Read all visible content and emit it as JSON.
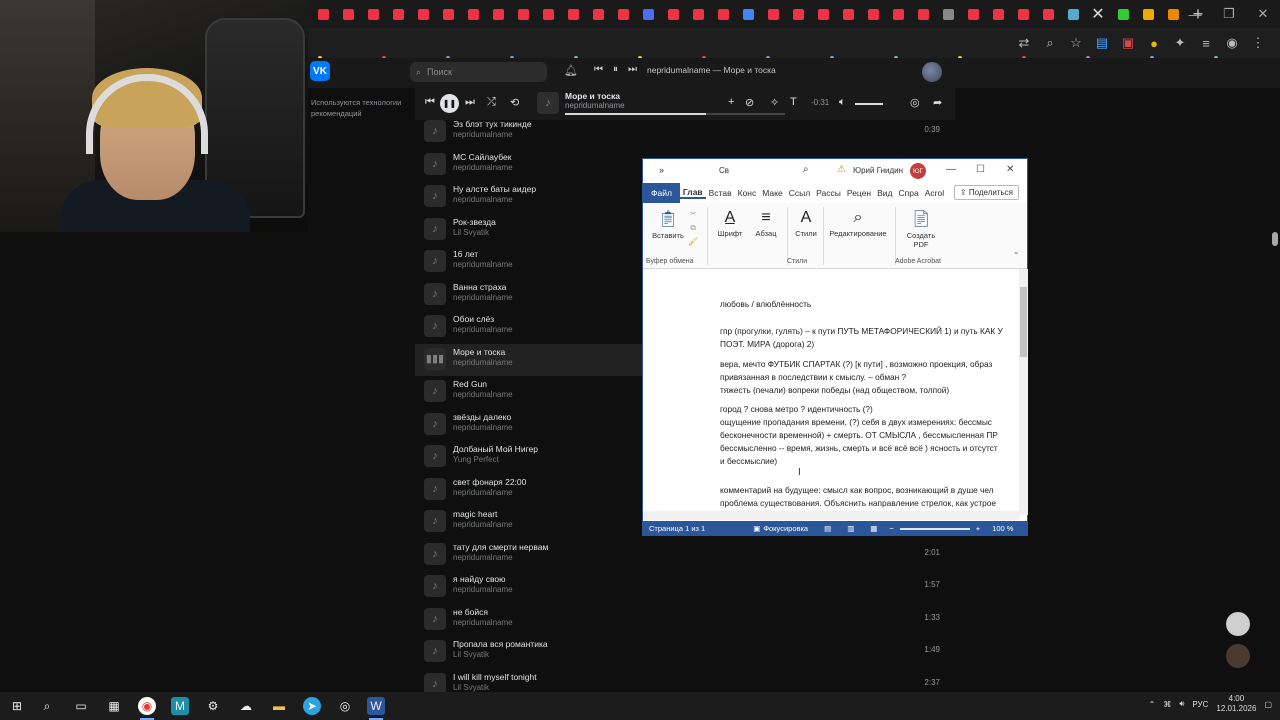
{
  "vk": {
    "logo": "VK",
    "search_placeholder": "Поиск",
    "now_playing_header": "nepridumalname — Море и тоска",
    "sidebar_note": "Используются технологии рекомендаций"
  },
  "player": {
    "title": "Море и тоска",
    "artist": "nepridumalname",
    "time": "-0:31",
    "progress": 0.64,
    "volume": 0.7
  },
  "tracks": [
    {
      "title": "Эз блэт тух тикинде",
      "artist": "nepridumalname",
      "duration": "0:39"
    },
    {
      "title": "MC Сайлаубек",
      "artist": "nepridumalname",
      "duration": ""
    },
    {
      "title": "Ну алсте баты аидер",
      "artist": "nepridumalname",
      "duration": ""
    },
    {
      "title": "Рок-звезда",
      "artist": "Lil Svyatik",
      "duration": ""
    },
    {
      "title": "16 лет",
      "artist": "nepridumalname",
      "duration": ""
    },
    {
      "title": "Ванна страха",
      "artist": "nepridumalname",
      "duration": ""
    },
    {
      "title": "Обои слёз",
      "artist": "nepridumalname",
      "duration": ""
    },
    {
      "title": "Море и тоска",
      "artist": "nepridumalname",
      "duration": ""
    },
    {
      "title": "Red Gun",
      "artist": "nepridumalname",
      "duration": ""
    },
    {
      "title": "звёзды далеко",
      "artist": "nepridumalname",
      "duration": ""
    },
    {
      "title": "Долбаный Мой Нигер",
      "artist": "Yung Perfect",
      "duration": ""
    },
    {
      "title": "свет фонаря 22:00",
      "artist": "nepridumalname",
      "duration": ""
    },
    {
      "title": "magic heart",
      "artist": "nepridumalname",
      "duration": ""
    },
    {
      "title": "тату для смерти нервам",
      "artist": "nepridumalname",
      "duration": "2:01"
    },
    {
      "title": "я найду свою",
      "artist": "nepridumalname",
      "duration": "1:57"
    },
    {
      "title": "не бойся",
      "artist": "nepridumalname",
      "duration": "1:33"
    },
    {
      "title": "Пропала вся романтика",
      "artist": "Lil Svyatik",
      "duration": "1:49"
    },
    {
      "title": "I will kill myself tonight",
      "artist": "Lil Svyatik",
      "duration": "2:37"
    }
  ],
  "word": {
    "title_short": "Св",
    "user": "Юрий Гнидин",
    "user_initials": "ЮГ",
    "tabs": [
      "Файл",
      "Глав",
      "Встав",
      "Конс",
      "Маке",
      "Ссыл",
      "Рассы",
      "Рецен",
      "Вид",
      "Спра",
      "Acrol"
    ],
    "share": "Поделиться",
    "ribbon": {
      "paste": "Вставить",
      "font": "Шрифт",
      "paragraph": "Абзац",
      "styles": "Стили",
      "editing": "Редактирование",
      "create_pdf_1": "Создать",
      "create_pdf_2": "PDF",
      "group_clipboard": "Буфер обмена",
      "group_styles": "Стили",
      "group_acrobat": "Adobe Acrobat"
    },
    "doc_lines": [
      "любовь / влюблённость",
      "гпр (прогулки, гулять) – к пути  ПУТЬ МЕТАФОРИЧЕСКИЙ 1) и путь КАК У",
      "ПОЭТ. МИРА (дорога) 2)",
      "вера, мечто ФУТБИК СПАРТАК (?) [к пути] , возможно проекция, образ",
      "привязанная в последствии к смыслу. – обман ?",
      "тяжесть (печали) вопреки победы (над обществом, толпой)",
      "город ?  снова метро ? идентичность (?)",
      "ощущение пропадания времени,  (?) себя в двух измерениях: бессмыс",
      "бесконечности временной) + смерть. ОТ СМЫСЛА ,  бессмысленная ПР",
      "бессмысленно -- время, жизнь, смерть и всё всё всё ) ясность и отсутст",
      "и бессмыслие)",
      "комментарий на будущее: смысл как вопрос, возникающий в душе чел",
      "проблема существования. Объяснить направление стрелок, как устрое"
    ],
    "status_page": "Страница 1 из 1",
    "status_focus": "Фокусировка",
    "status_zoom": "100 %"
  },
  "taskbar": {
    "lang": "РУС",
    "time": "4:00",
    "date": "12.01.2026"
  }
}
